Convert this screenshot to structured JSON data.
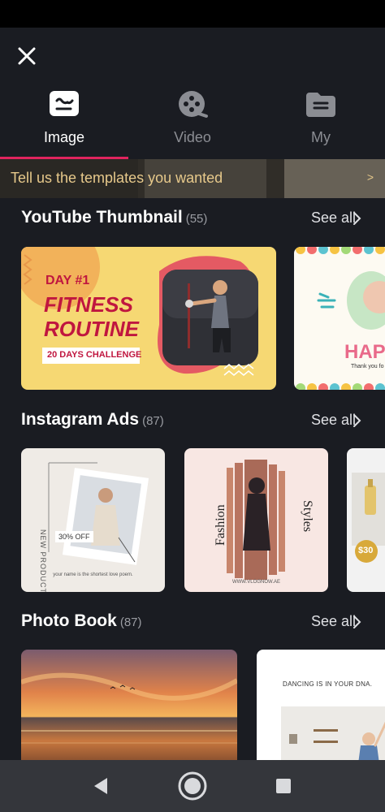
{
  "tabs": [
    {
      "label": "Image",
      "icon": "image-icon",
      "active": true
    },
    {
      "label": "Video",
      "icon": "video-reel-icon",
      "active": false
    },
    {
      "label": "My",
      "icon": "folder-icon",
      "active": false
    }
  ],
  "banner": {
    "text": "Tell us the templates you wanted",
    "arrow": ">"
  },
  "sections": [
    {
      "title": "YouTube Thumbnail",
      "count": "(55)",
      "see_all": "See all",
      "cards": [
        {
          "day": "DAY #1",
          "line1": "FITNESS",
          "line2": "ROUTINE",
          "badge": "20 DAYS CHALLENGE"
        },
        {
          "title": "HAP",
          "sub": "Thank you fo"
        }
      ]
    },
    {
      "title": "Instagram Ads",
      "count": "(87)",
      "see_all": "See all",
      "cards": [
        {
          "vertical": "NEW PRODUCT",
          "discount": "30% OFF",
          "footer": "your name is the shortest love poem."
        },
        {
          "left": "Fashion",
          "right": "Styles",
          "footer": "WWW.VLOGNOW.AE"
        },
        {
          "price": "$30"
        }
      ]
    },
    {
      "title": "Photo Book",
      "count": "(87)",
      "see_all": "See all",
      "cards": [
        {
          "scene": "sunset-beach"
        },
        {
          "caption": "DANCING IS IN YOUR DNA."
        }
      ]
    }
  ],
  "colors": {
    "accent": "#e0245e",
    "banner_text": "#e7c98b",
    "background": "#1a1c22"
  }
}
